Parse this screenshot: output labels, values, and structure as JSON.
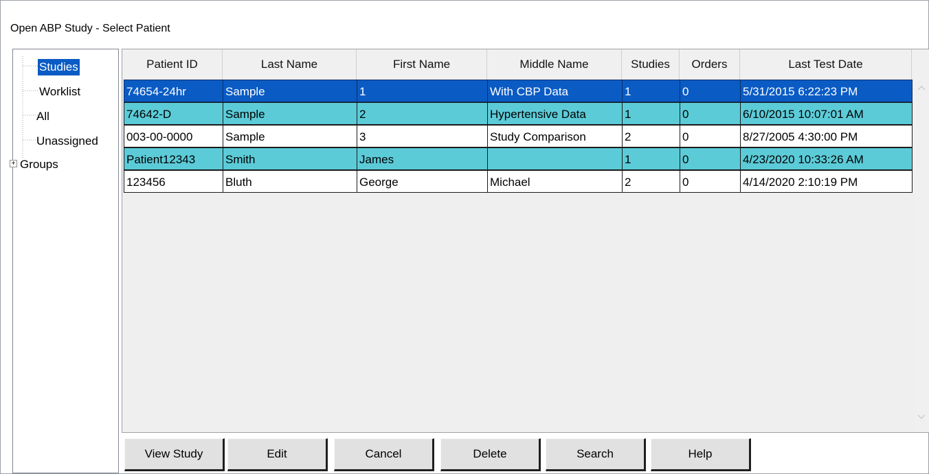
{
  "window": {
    "title": "Open ABP Study - Select Patient"
  },
  "tree": {
    "items": [
      {
        "label": "Studies",
        "selected": true
      },
      {
        "label": "Worklist",
        "selected": false
      },
      {
        "label": "All",
        "selected": false
      },
      {
        "label": "Unassigned",
        "selected": false
      },
      {
        "label": "Groups",
        "selected": false,
        "expandable": true,
        "expander": "+"
      }
    ]
  },
  "grid": {
    "columns": [
      "Patient ID",
      "Last Name",
      "First Name",
      "Middle Name",
      "Studies",
      "Orders",
      "Last Test Date"
    ],
    "rows": [
      {
        "style": "selected",
        "cells": [
          "74654-24hr",
          "Sample",
          "1",
          "With CBP Data",
          "1",
          "0",
          "5/31/2015 6:22:23 PM"
        ]
      },
      {
        "style": "teal",
        "cells": [
          "74642-D",
          "Sample",
          "2",
          "Hypertensive Data",
          "1",
          "0",
          "6/10/2015 10:07:01 AM"
        ]
      },
      {
        "style": "white",
        "cells": [
          "003-00-0000",
          "Sample",
          "3",
          "Study Comparison",
          "2",
          "0",
          "8/27/2005 4:30:00 PM"
        ]
      },
      {
        "style": "teal",
        "cells": [
          "Patient12343",
          "Smith",
          "James",
          "",
          "1",
          "0",
          "4/23/2020 10:33:26 AM"
        ]
      },
      {
        "style": "white",
        "cells": [
          "123456",
          "Bluth",
          "George",
          "Michael",
          "2",
          "0",
          "4/14/2020 2:10:19 PM"
        ]
      }
    ],
    "scroll_up_icon": "chevron-up-icon",
    "scroll_down_icon": "chevron-down-icon"
  },
  "buttons": {
    "view_study": "View Study",
    "edit": "Edit",
    "cancel": "Cancel",
    "delete": "Delete",
    "search": "Search",
    "help": "Help"
  },
  "colors": {
    "selection": "#0a5bc4",
    "highlight_row": "#5ccbd8"
  }
}
